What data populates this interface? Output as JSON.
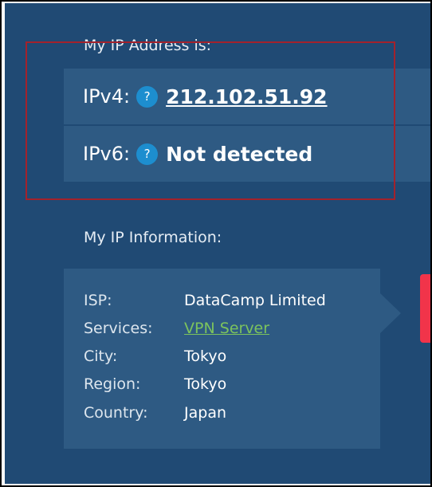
{
  "ip_address": {
    "title": "My IP Address is:",
    "ipv4": {
      "label": "IPv4:",
      "help": "?",
      "value": "212.102.51.92"
    },
    "ipv6": {
      "label": "IPv6:",
      "help": "?",
      "value": "Not detected"
    }
  },
  "ip_information": {
    "title": "My IP Information:",
    "rows": [
      {
        "key": "ISP:",
        "value": "DataCamp Limited"
      },
      {
        "key": "Services:",
        "value": "VPN Server"
      },
      {
        "key": "City:",
        "value": "Tokyo"
      },
      {
        "key": "Region:",
        "value": "Tokyo"
      },
      {
        "key": "Country:",
        "value": "Japan"
      }
    ]
  },
  "colors": {
    "background": "#204a74",
    "row_background": "#2e5a83",
    "help_icon": "#1d8ecf",
    "link_green": "#7cc35d",
    "highlight_box": "#a3222c",
    "side_tab": "#f1344a"
  }
}
